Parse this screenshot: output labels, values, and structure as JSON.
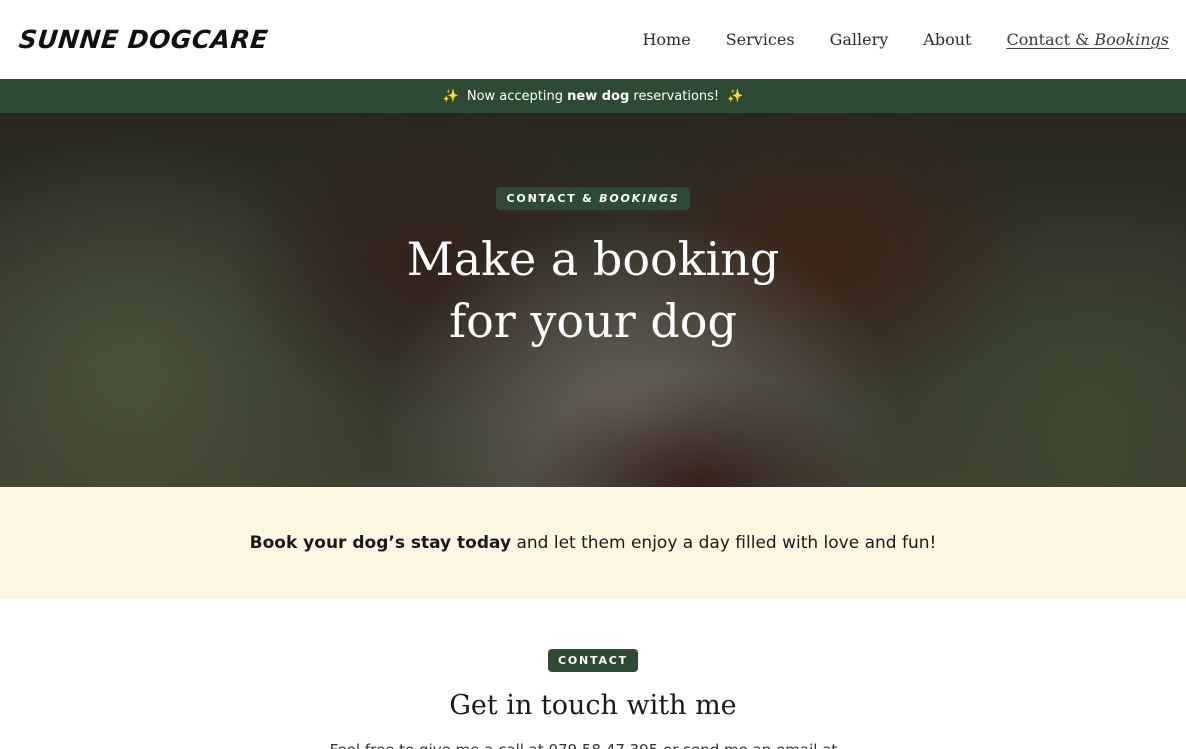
{
  "header": {
    "logo": "SUNNE DOGCARE",
    "nav": [
      {
        "label": "Home"
      },
      {
        "label": "Services"
      },
      {
        "label": "Gallery"
      },
      {
        "label": "About"
      },
      {
        "label_prefix": "Contact & ",
        "label_em": "Bookings"
      }
    ]
  },
  "announcement": {
    "prefix": "Now accepting ",
    "bold": "new dog",
    "suffix": " reservations!",
    "sparkle": "✨"
  },
  "hero": {
    "pill_prefix": "CONTACT & ",
    "pill_em": "BOOKINGS",
    "title_line1": "Make a booking",
    "title_line2": "for your dog"
  },
  "cream": {
    "bold": "Book your dog’s stay today",
    "rest": " and let them enjoy a day filled with love and fun!"
  },
  "contact": {
    "pill": "CONTACT",
    "title": "Get in touch with me",
    "text": "Feel free to give me a call at 079 58 47 395 or send me an email at ..."
  },
  "colors": {
    "brand_green": "#2f4a32",
    "cream": "#fdf6e3"
  }
}
